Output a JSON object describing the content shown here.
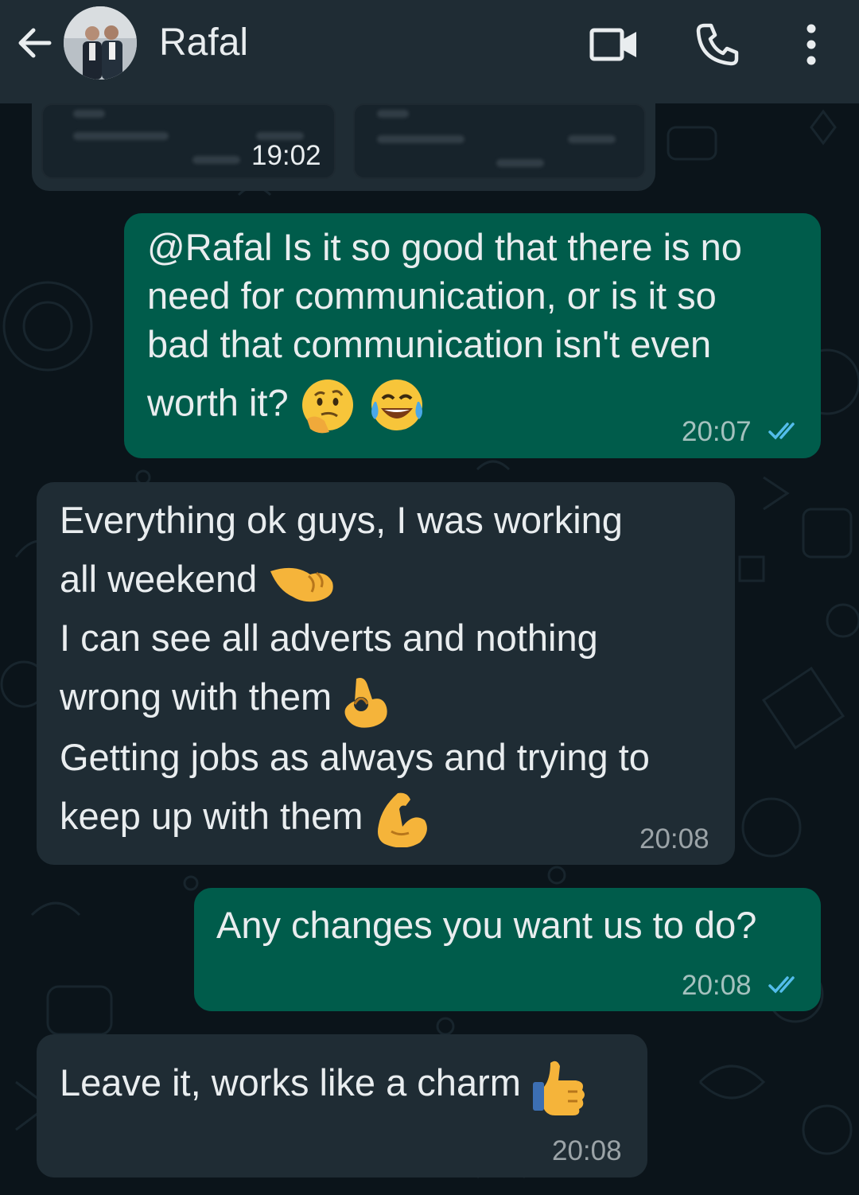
{
  "header": {
    "contact_name": "Rafal",
    "back_icon": "arrow-left-icon",
    "video_icon": "video-camera-icon",
    "call_icon": "phone-icon",
    "menu_icon": "more-vert-icon"
  },
  "colors": {
    "header_bg": "#1f2c34",
    "chat_bg": "#0b141a",
    "incoming_bubble": "#1f2c34",
    "outgoing_bubble": "#005c4b",
    "read_tick": "#53bdeb"
  },
  "messages": [
    {
      "direction": "incoming",
      "type": "image",
      "time": "19:02"
    },
    {
      "direction": "outgoing",
      "lines": [
        "@Rafal Is it so good that there is no",
        "need for communication, or is it so",
        "bad that communication isn't even",
        "worth it?"
      ],
      "emojis": [
        "thinking-face-emoji",
        "tears-of-joy-emoji"
      ],
      "time": "20:07",
      "status": "read"
    },
    {
      "direction": "incoming",
      "lines": [
        "Everything ok guys, I was working",
        "all weekend",
        "I can see all adverts and nothing",
        "wrong with them",
        "Getting jobs as always and trying to",
        "keep up with them"
      ],
      "emojis": [
        "fist-bump-emoji",
        "ok-hand-emoji",
        "flexed-biceps-emoji"
      ],
      "time": "20:08"
    },
    {
      "direction": "outgoing",
      "lines": [
        "Any changes you want us to do?"
      ],
      "time": "20:08",
      "status": "read"
    },
    {
      "direction": "incoming",
      "lines": [
        "Leave it, works like a charm"
      ],
      "emojis": [
        "thumbs-up-emoji"
      ],
      "time": "20:08"
    }
  ]
}
